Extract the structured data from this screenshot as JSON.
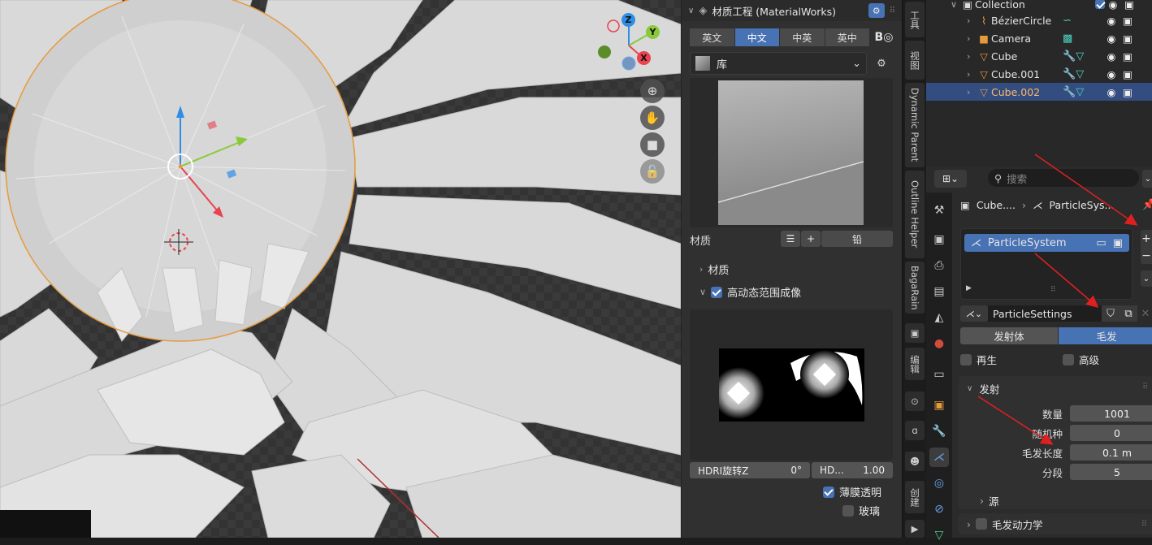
{
  "viewport": {
    "gizmo": {
      "z": "Z",
      "y": "Y",
      "x": "X"
    },
    "colors": {
      "x": "#e8434f",
      "y": "#8ac93a",
      "z": "#2e8ee5",
      "selection": "#e59a3b"
    },
    "nav_icons": [
      "zoom-icon",
      "hand-icon",
      "camera-icon",
      "lock-icon"
    ]
  },
  "material_works": {
    "title": "材质工程 (MaterialWorks)",
    "languages": [
      "英文",
      "中文",
      "中英",
      "英中"
    ],
    "active_language": "中文",
    "library_label": "库",
    "material_label": "材质",
    "lead_button": "铅",
    "section_material": "材质",
    "section_hdr": "高动态范围成像",
    "hdri_rotate_label": "HDRI旋转Z",
    "hdri_rotate_value": "0°",
    "hd_label": "HD...",
    "hd_value": "1.00",
    "film_transparent": "薄膜透明",
    "glass": "玻璃"
  },
  "vertical_tabs": [
    "工具",
    "视图",
    "Dynamic Parent",
    "Outline Helper",
    "BagaRain",
    "编辑",
    "创建"
  ],
  "outliner": {
    "collection": "Collection",
    "items": [
      {
        "name": "BézierCircle",
        "icon": "curve-icon",
        "selected": false
      },
      {
        "name": "Camera",
        "icon": "camera-object-icon",
        "selected": false
      },
      {
        "name": "Cube",
        "icon": "mesh-icon",
        "selected": false
      },
      {
        "name": "Cube.001",
        "icon": "mesh-icon",
        "selected": false
      },
      {
        "name": "Cube.002",
        "icon": "mesh-icon",
        "selected": true
      }
    ]
  },
  "properties": {
    "search_placeholder": "搜索",
    "breadcrumb_object": "Cube....",
    "breadcrumb_system": "ParticleSys...",
    "particle_system": "ParticleSystem",
    "particle_settings": "ParticleSettings",
    "type_emitter": "发射体",
    "type_hair": "毛发",
    "regrow": "再生",
    "advanced": "高级",
    "emission_section": "发射",
    "fields": [
      {
        "label": "数量",
        "value": "1001"
      },
      {
        "label": "随机种",
        "value": "0"
      },
      {
        "label": "毛发长度",
        "value": "0.1 m"
      },
      {
        "label": "分段",
        "value": "5"
      }
    ],
    "source_section": "源",
    "hair_dynamics": "毛发动力学"
  }
}
